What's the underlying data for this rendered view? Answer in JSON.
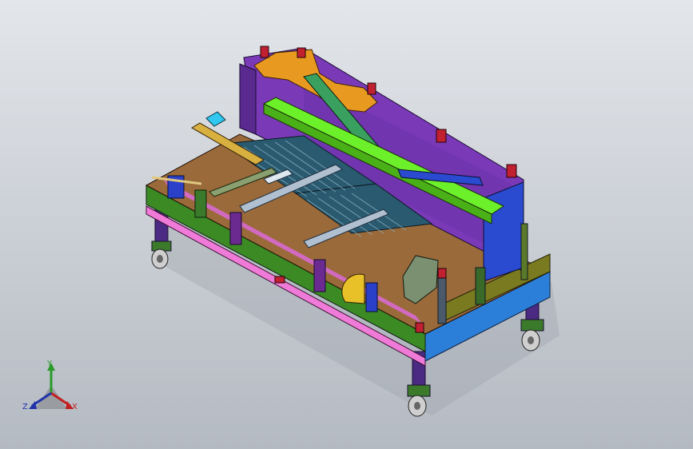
{
  "viewport": {
    "model_name": "welding-fixture-assembly"
  },
  "triad": {
    "y_label": "Y",
    "z_label": "Z",
    "x_label": "X",
    "colors": {
      "x": "#c02020",
      "y": "#2a9a2a",
      "z": "#2233aa"
    }
  }
}
